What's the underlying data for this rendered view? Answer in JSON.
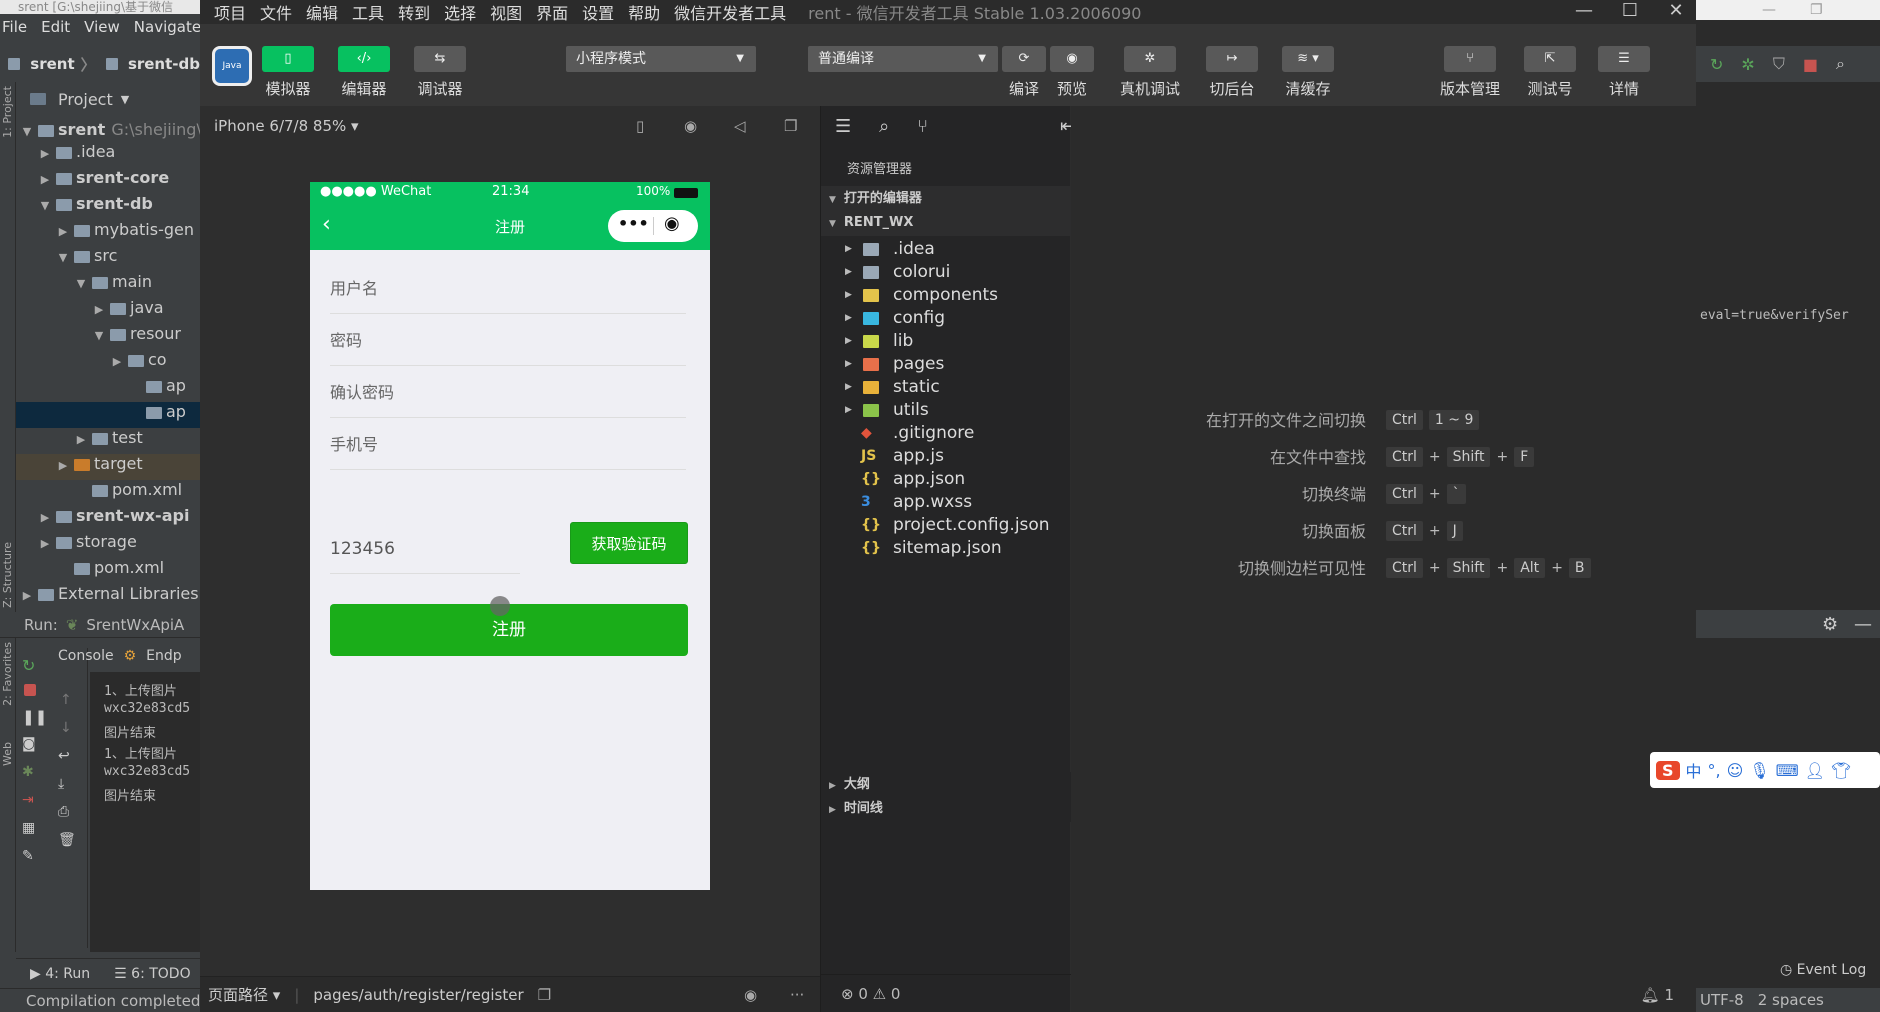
{
  "intellij": {
    "title": "srent [G:\\shejiing\\基于微信",
    "menu": [
      "File",
      "Edit",
      "View",
      "Navigate"
    ],
    "breadcrumb": [
      "srent",
      "srent-db"
    ],
    "sidebar_tabs": [
      "1: Project",
      "Z: Structure",
      "2: Favorites",
      "Web"
    ],
    "project_label": "Project",
    "tree": [
      {
        "label": "srent",
        "extra": "G:\\shejiing\\基",
        "level": 0,
        "arrow": "▼",
        "bold": true
      },
      {
        "label": ".idea",
        "level": 1,
        "arrow": "▶"
      },
      {
        "label": "srent-core",
        "level": 1,
        "arrow": "▶",
        "bold": true
      },
      {
        "label": "srent-db",
        "level": 1,
        "arrow": "▼",
        "bold": true
      },
      {
        "label": "mybatis-gen",
        "level": 2,
        "arrow": "▶"
      },
      {
        "label": "src",
        "level": 2,
        "arrow": "▼"
      },
      {
        "label": "main",
        "level": 3,
        "arrow": "▼"
      },
      {
        "label": "java",
        "level": 4,
        "arrow": "▶"
      },
      {
        "label": "resour",
        "level": 4,
        "arrow": "▼"
      },
      {
        "label": "co",
        "level": 5,
        "arrow": "▶"
      },
      {
        "label": "ap",
        "level": 6,
        "arrow": ""
      },
      {
        "label": "ap",
        "level": 6,
        "arrow": "",
        "selected": true
      },
      {
        "label": "test",
        "level": 3,
        "arrow": "▶"
      },
      {
        "label": "target",
        "level": 2,
        "arrow": "▶",
        "target": true
      },
      {
        "label": "pom.xml",
        "level": 3,
        "arrow": ""
      },
      {
        "label": "srent-wx-api",
        "level": 1,
        "arrow": "▶",
        "bold": true
      },
      {
        "label": "storage",
        "level": 1,
        "arrow": "▶"
      },
      {
        "label": "pom.xml",
        "level": 2,
        "arrow": ""
      },
      {
        "label": "External Libraries",
        "level": 0,
        "arrow": "▶"
      }
    ],
    "run_label": "Run:",
    "run_config": "SrentWxApiA",
    "console_tabs": [
      "Console",
      "Endp"
    ],
    "console_lines": [
      "1、上传图片",
      "wxc32e83cd5",
      "图片结束",
      "1、上传图片",
      "wxc32e83cd5",
      "图片结束"
    ],
    "bottom_tabs": [
      "4: Run",
      "6: TODO"
    ],
    "status": "Compilation completed"
  },
  "wx": {
    "menu": [
      "项目",
      "文件",
      "编辑",
      "工具",
      "转到",
      "选择",
      "视图",
      "界面",
      "设置",
      "帮助",
      "微信开发者工具"
    ],
    "app_title": "rent - 微信开发者工具 Stable 1.03.2006090",
    "avatar_text": "Java",
    "tools": {
      "simulator": "模拟器",
      "editor": "编辑器",
      "debugger": "调试器",
      "compile": "编译",
      "preview": "预览",
      "remote": "真机调试",
      "background": "切后台",
      "clearcache": "清缓存",
      "version": "版本管理",
      "testnum": "测试号",
      "details": "详情"
    },
    "mode": "小程序模式",
    "compile_mode": "普通编译",
    "device": "iPhone 6/7/8 85%",
    "phone": {
      "signal": "●●●●● WeChat",
      "time": "21:34",
      "battery": "100%",
      "nav_title": "注册",
      "fields": [
        "用户名",
        "密码",
        "确认密码",
        "手机号"
      ],
      "code_value": "123456",
      "get_code": "获取验证码",
      "submit": "注册"
    },
    "page_path_label": "页面路径",
    "page_path": "pages/auth/register/register",
    "explorer": {
      "title": "资源管理器",
      "open_editors": "打开的编辑器",
      "project": "RENT_WX",
      "files": [
        {
          "name": ".idea",
          "type": "folder",
          "color": "#9aa8b6"
        },
        {
          "name": "colorui",
          "type": "folder",
          "color": "#9aa8b6"
        },
        {
          "name": "components",
          "type": "folder",
          "color": "#e3c34b"
        },
        {
          "name": "config",
          "type": "folder",
          "color": "#39b7e0"
        },
        {
          "name": "lib",
          "type": "folder",
          "color": "#c9d84a"
        },
        {
          "name": "pages",
          "type": "folder",
          "color": "#e8704a"
        },
        {
          "name": "static",
          "type": "folder",
          "color": "#e8b13a"
        },
        {
          "name": "utils",
          "type": "folder",
          "color": "#8bc34a"
        },
        {
          "name": ".gitignore",
          "type": "file",
          "glyph": "◆",
          "color": "#e2543c"
        },
        {
          "name": "app.js",
          "type": "file",
          "glyph": "JS",
          "color": "#e3c34b"
        },
        {
          "name": "app.json",
          "type": "file",
          "glyph": "{}",
          "color": "#e3c34b"
        },
        {
          "name": "app.wxss",
          "type": "file",
          "glyph": "3",
          "color": "#3b8ee0"
        },
        {
          "name": "project.config.json",
          "type": "file",
          "glyph": "{}",
          "color": "#e3c34b"
        },
        {
          "name": "sitemap.json",
          "type": "file",
          "glyph": "{}",
          "color": "#e3c34b"
        }
      ],
      "outline": "大纲",
      "timeline": "时间线",
      "problems": "⊗ 0 ⚠ 0"
    },
    "hotkeys": [
      {
        "label": "在打开的文件之间切换",
        "keys": [
          "Ctrl",
          "1 ~ 9"
        ]
      },
      {
        "label": "在文件中查找",
        "keys": [
          "Ctrl",
          "+",
          "Shift",
          "+",
          "F"
        ]
      },
      {
        "label": "切换终端",
        "keys": [
          "Ctrl",
          "+",
          "`"
        ]
      },
      {
        "label": "切换面板",
        "keys": [
          "Ctrl",
          "+",
          "J"
        ]
      },
      {
        "label": "切换侧边栏可见性",
        "keys": [
          "Ctrl",
          "+",
          "Shift",
          "+",
          "Alt",
          "+",
          "B"
        ]
      }
    ]
  },
  "ij_right": {
    "code_fragment": "eval=true&verifySer",
    "event_log": "Event Log",
    "encoding": "UTF-8",
    "indent": "2 spaces",
    "ime_label": "中"
  }
}
